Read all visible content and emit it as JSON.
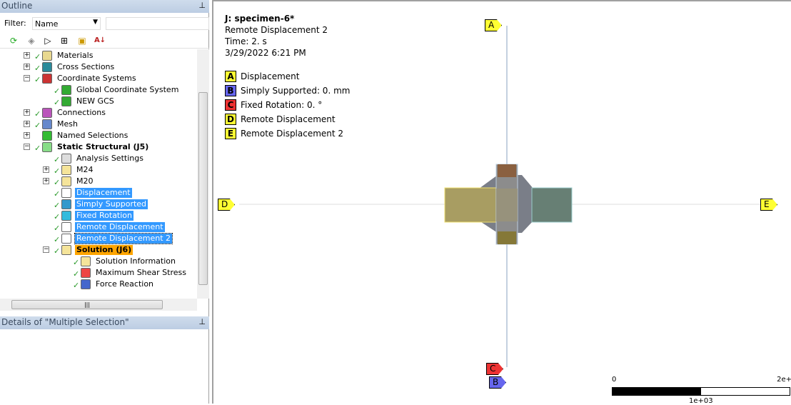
{
  "outline": {
    "title": "Outline",
    "filter_label": "Filter:",
    "filter_value": "Name",
    "tree": [
      {
        "label": "Materials",
        "level": 1,
        "exp": "+",
        "icon": "materials-icon",
        "color": "#e8d890"
      },
      {
        "label": "Cross Sections",
        "level": 1,
        "exp": "+",
        "icon": "cross-sections-icon",
        "color": "#2a8a9a"
      },
      {
        "label": "Coordinate Systems",
        "level": 1,
        "exp": "-",
        "icon": "coordinate-systems-icon",
        "color": "#c33"
      },
      {
        "label": "Global Coordinate System",
        "level": 2,
        "icon": "coordinate-system-icon",
        "color": "#3a3"
      },
      {
        "label": "NEW GCS",
        "level": 2,
        "icon": "coordinate-system-icon",
        "color": "#3a3"
      },
      {
        "label": "Connections",
        "level": 1,
        "exp": "+",
        "icon": "connections-icon",
        "color": "#b5b"
      },
      {
        "label": "Mesh",
        "level": 1,
        "exp": "+",
        "icon": "mesh-icon",
        "color": "#68c"
      },
      {
        "label": "Named Selections",
        "level": 1,
        "exp": "+",
        "icon": "named-selections-icon",
        "color": "#3b3",
        "nocheck": true
      },
      {
        "label": "Static Structural (J5)",
        "level": 1,
        "exp": "-",
        "icon": "static-structural-icon",
        "color": "#8d8",
        "style": "bold"
      },
      {
        "label": "Analysis Settings",
        "level": 2,
        "icon": "analysis-settings-icon",
        "color": "#ddd"
      },
      {
        "label": "M24",
        "level": 2,
        "exp": "+",
        "icon": "folder-icon",
        "color": "#f5e49a"
      },
      {
        "label": "M20",
        "level": 2,
        "exp": "+",
        "icon": "folder-icon",
        "color": "#f5e49a"
      },
      {
        "label": "Displacement",
        "level": 2,
        "icon": "displacement-icon",
        "color": "#fff",
        "style": "sel"
      },
      {
        "label": "Simply Supported",
        "level": 2,
        "icon": "simply-supported-icon",
        "color": "#39c",
        "style": "sel"
      },
      {
        "label": "Fixed Rotation",
        "level": 2,
        "icon": "fixed-rotation-icon",
        "color": "#3bd",
        "style": "sel"
      },
      {
        "label": "Remote Displacement",
        "level": 2,
        "icon": "remote-displacement-icon",
        "color": "#fff",
        "style": "sel"
      },
      {
        "label": "Remote Displacement 2",
        "level": 2,
        "icon": "remote-displacement-icon",
        "color": "#fff",
        "style": "focus"
      },
      {
        "label": "Solution (J6)",
        "level": 2,
        "exp": "-",
        "icon": "solution-icon",
        "color": "#f5e49a",
        "style": "sol"
      },
      {
        "label": "Solution Information",
        "level": 3,
        "icon": "solution-information-icon",
        "color": "#f5e49a"
      },
      {
        "label": "Maximum Shear Stress",
        "level": 3,
        "icon": "shear-stress-icon",
        "color": "#e44"
      },
      {
        "label": "Force Reaction",
        "level": 3,
        "icon": "force-reaction-icon",
        "color": "#46c"
      }
    ]
  },
  "details": {
    "title": "Details of \"Multiple Selection\""
  },
  "viewport": {
    "model": "J: specimen-6*",
    "object": "Remote Displacement 2",
    "time": "Time: 2. s",
    "date": "3/29/2022 6:21 PM",
    "legend": [
      {
        "key": "A",
        "label": "Displacement",
        "color": "#ffff33"
      },
      {
        "key": "B",
        "label": "Simply Supported: 0. mm",
        "color": "#6666ee"
      },
      {
        "key": "C",
        "label": "Fixed Rotation: 0. °",
        "color": "#ee3333"
      },
      {
        "key": "D",
        "label": "Remote Displacement",
        "color": "#ffff33"
      },
      {
        "key": "E",
        "label": "Remote Displacement 2",
        "color": "#ffff33"
      }
    ],
    "scale": {
      "min": "0",
      "max": "2e+",
      "mid": "1e+03"
    }
  }
}
